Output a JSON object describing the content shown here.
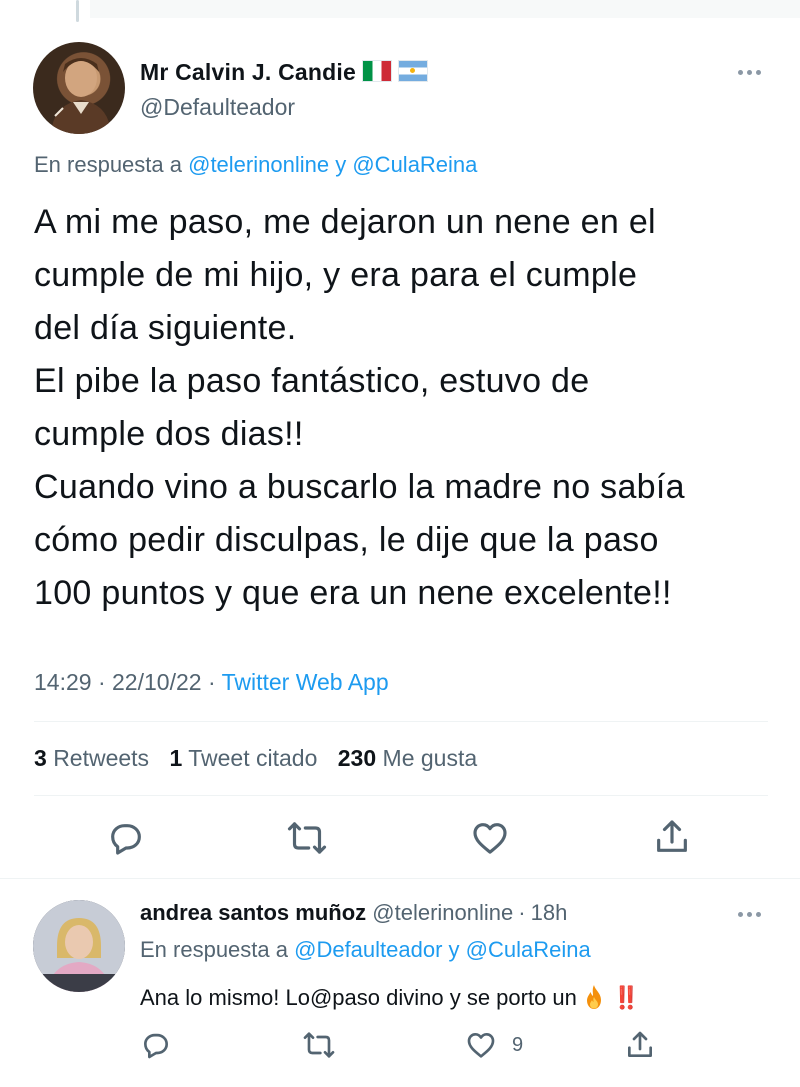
{
  "tweet": {
    "display_name": "Mr Calvin J. Candie",
    "flags": [
      "italy-flag",
      "argentina-flag"
    ],
    "handle": "@Defaulteador",
    "replying_prefix": "En respuesta a",
    "replying_mention_1": "@telerinonline",
    "replying_joiner": "y",
    "replying_mention_2": "@CulaReina",
    "text_lines": [
      "A mi me paso, me dejaron un nene en el",
      "cumple de mi hijo, y era para el cumple",
      "del día siguiente.",
      "El pibe la paso fantástico, estuvo de",
      "cumple dos dias!!",
      "Cuando vino a buscarlo la madre no sabía",
      "cómo pedir disculpas, le dije que la paso",
      "100 puntos y que era un nene excelente!!"
    ],
    "time": "14:29",
    "date": "22/10/22",
    "separator": "·",
    "source": "Twitter Web App",
    "stats": {
      "retweets_count": "3",
      "retweets_label": "Retweets",
      "quotes_count": "1",
      "quotes_label": "Tweet citado",
      "likes_count": "230",
      "likes_label": "Me gusta"
    }
  },
  "reply": {
    "display_name": "andrea santos muñoz",
    "handle": "@telerinonline",
    "separator": "·",
    "age": "18h",
    "replying_prefix": "En respuesta a",
    "replying_mention_1": "@Defaulteador",
    "replying_joiner": "y",
    "replying_mention_2": "@CulaReina",
    "text": "Ana lo mismo! Lo@paso divino y se porto un",
    "emoji": "fire-emoji",
    "trailing": "‼️",
    "like_count": "9"
  },
  "colors": {
    "accent": "#1d9bf0",
    "secondary_text": "#536471",
    "icon": "#536471",
    "divider": "#eff3f4"
  }
}
